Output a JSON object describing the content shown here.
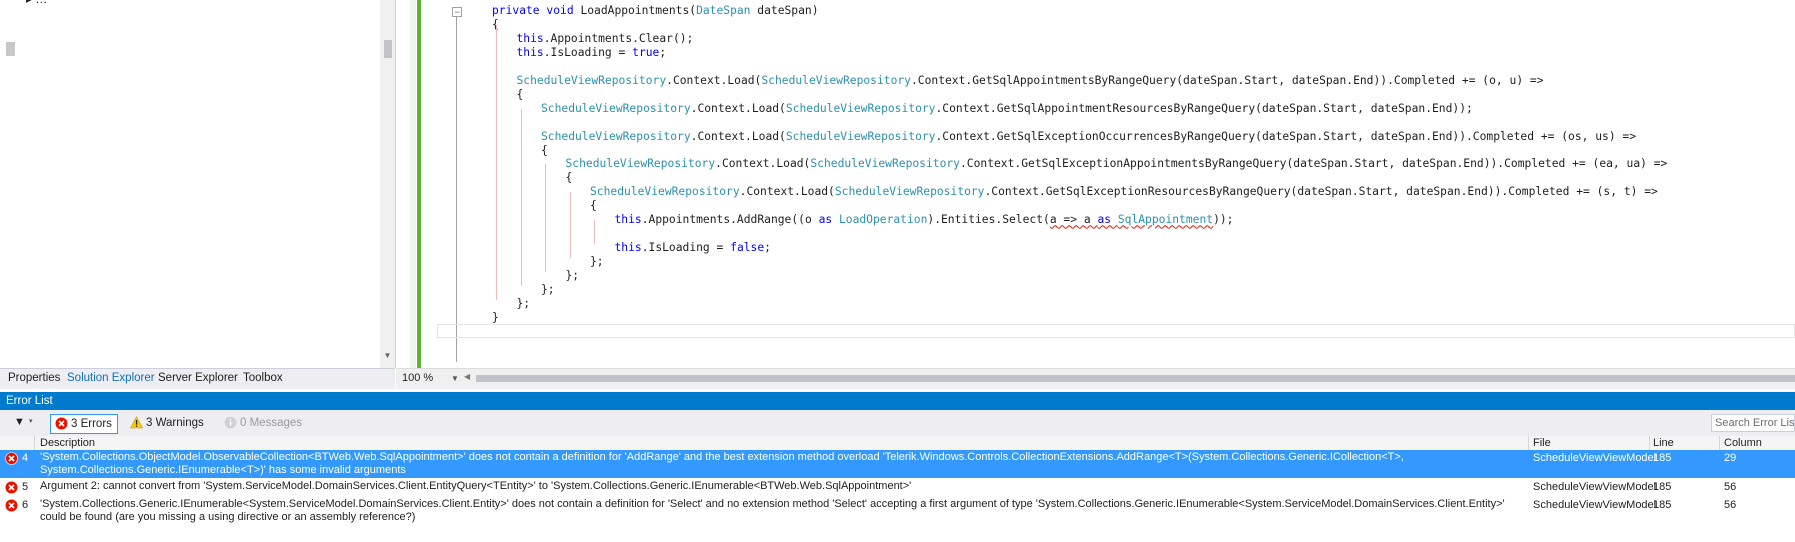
{
  "solution_explorer": {
    "tree_item_fragment": "▸ …",
    "tabs": [
      "Properties",
      "Solution Explorer",
      "Server Explorer",
      "Toolbox"
    ],
    "active_tab": "Solution Explorer"
  },
  "editor": {
    "zoom": "100 %",
    "code_lines": [
      {
        "indent": 0,
        "tokens": [
          {
            "t": "private ",
            "c": "kw"
          },
          {
            "t": "void ",
            "c": "kw"
          },
          {
            "t": "LoadAppointments(",
            "c": ""
          },
          {
            "t": "DateSpan",
            "c": "ty"
          },
          {
            "t": " dateSpan)",
            "c": ""
          }
        ]
      },
      {
        "indent": 0,
        "tokens": [
          {
            "t": "{",
            "c": ""
          }
        ]
      },
      {
        "indent": 1,
        "tokens": [
          {
            "t": "this",
            "c": "kw"
          },
          {
            "t": ".Appointments.Clear();",
            "c": ""
          }
        ]
      },
      {
        "indent": 1,
        "tokens": [
          {
            "t": "this",
            "c": "kw"
          },
          {
            "t": ".IsLoading = ",
            "c": ""
          },
          {
            "t": "true",
            "c": "kw"
          },
          {
            "t": ";",
            "c": ""
          }
        ]
      },
      {
        "indent": 1,
        "tokens": []
      },
      {
        "indent": 1,
        "tokens": [
          {
            "t": "ScheduleViewRepository",
            "c": "ty"
          },
          {
            "t": ".Context.Load(",
            "c": ""
          },
          {
            "t": "ScheduleViewRepository",
            "c": "ty"
          },
          {
            "t": ".Context.GetSqlAppointmentsByRangeQuery(dateSpan.Start, dateSpan.End)).Completed += (o, u) =>",
            "c": ""
          }
        ]
      },
      {
        "indent": 1,
        "tokens": [
          {
            "t": "{",
            "c": ""
          }
        ]
      },
      {
        "indent": 2,
        "tokens": [
          {
            "t": "ScheduleViewRepository",
            "c": "ty"
          },
          {
            "t": ".Context.Load(",
            "c": ""
          },
          {
            "t": "ScheduleViewRepository",
            "c": "ty"
          },
          {
            "t": ".Context.GetSqlAppointmentResourcesByRangeQuery(dateSpan.Start, dateSpan.End));",
            "c": ""
          }
        ]
      },
      {
        "indent": 2,
        "tokens": []
      },
      {
        "indent": 2,
        "tokens": [
          {
            "t": "ScheduleViewRepository",
            "c": "ty"
          },
          {
            "t": ".Context.Load(",
            "c": ""
          },
          {
            "t": "ScheduleViewRepository",
            "c": "ty"
          },
          {
            "t": ".Context.GetSqlExceptionOccurrencesByRangeQuery(dateSpan.Start, dateSpan.End)).Completed += (os, us) =>",
            "c": ""
          }
        ]
      },
      {
        "indent": 2,
        "tokens": [
          {
            "t": "{",
            "c": ""
          }
        ]
      },
      {
        "indent": 3,
        "tokens": [
          {
            "t": "ScheduleViewRepository",
            "c": "ty"
          },
          {
            "t": ".Context.Load(",
            "c": ""
          },
          {
            "t": "ScheduleViewRepository",
            "c": "ty"
          },
          {
            "t": ".Context.GetSqlExceptionAppointmentsByRangeQuery(dateSpan.Start, dateSpan.End)).Completed += (ea, ua) =>",
            "c": ""
          }
        ]
      },
      {
        "indent": 3,
        "tokens": [
          {
            "t": "{",
            "c": ""
          }
        ]
      },
      {
        "indent": 4,
        "tokens": [
          {
            "t": "ScheduleViewRepository",
            "c": "ty"
          },
          {
            "t": ".Context.Load(",
            "c": ""
          },
          {
            "t": "ScheduleViewRepository",
            "c": "ty"
          },
          {
            "t": ".Context.GetSqlExceptionResourcesByRangeQuery(dateSpan.Start, dateSpan.End)).Completed += (s, t) =>",
            "c": ""
          }
        ]
      },
      {
        "indent": 4,
        "tokens": [
          {
            "t": "{",
            "c": ""
          }
        ]
      },
      {
        "indent": 5,
        "tokens": [
          {
            "t": "this",
            "c": "kw"
          },
          {
            "t": ".Appointments.AddRange((o ",
            "c": ""
          },
          {
            "t": "as ",
            "c": "kw"
          },
          {
            "t": "LoadOperation",
            "c": "ty"
          },
          {
            "t": ").Entities.Select(",
            "c": ""
          },
          {
            "t": "a => a ",
            "c": "sq"
          },
          {
            "t": "as ",
            "c": "kw sq"
          },
          {
            "t": "SqlAppointment",
            "c": "ty sq"
          },
          {
            "t": "));",
            "c": ""
          }
        ]
      },
      {
        "indent": 5,
        "tokens": []
      },
      {
        "indent": 5,
        "tokens": [
          {
            "t": "this",
            "c": "kw"
          },
          {
            "t": ".IsLoading = ",
            "c": ""
          },
          {
            "t": "false",
            "c": "kw"
          },
          {
            "t": ";",
            "c": ""
          }
        ]
      },
      {
        "indent": 4,
        "tokens": [
          {
            "t": "};",
            "c": ""
          }
        ]
      },
      {
        "indent": 3,
        "tokens": [
          {
            "t": "};",
            "c": ""
          }
        ]
      },
      {
        "indent": 2,
        "tokens": [
          {
            "t": "};",
            "c": ""
          }
        ]
      },
      {
        "indent": 1,
        "tokens": [
          {
            "t": "};",
            "c": ""
          }
        ]
      },
      {
        "indent": 0,
        "tokens": [
          {
            "t": "}",
            "c": ""
          }
        ]
      }
    ]
  },
  "error_list": {
    "title": "Error List",
    "errors_label": "3 Errors",
    "warnings_label": "3 Warnings",
    "messages_label": "0 Messages",
    "search_placeholder": "Search Error List",
    "columns": {
      "description": "Description",
      "file": "File",
      "line": "Line",
      "column": "Column"
    },
    "rows": [
      {
        "num": "4",
        "description": "'System.Collections.ObjectModel.ObservableCollection<BTWeb.Web.SqlAppointment>' does not contain a definition for 'AddRange' and the best extension method overload 'Telerik.Windows.Controls.CollectionExtensions.AddRange<T>(System.Collections.Generic.ICollection<T>, System.Collections.Generic.IEnumerable<T>)' has some invalid arguments",
        "file": "ScheduleViewViewModel",
        "line": "185",
        "column": "29",
        "selected": true
      },
      {
        "num": "5",
        "description": "Argument 2: cannot convert from 'System.ServiceModel.DomainServices.Client.EntityQuery<TEntity>' to 'System.Collections.Generic.IEnumerable<BTWeb.Web.SqlAppointment>'",
        "file": "ScheduleViewViewModel",
        "line": "185",
        "column": "56",
        "selected": false
      },
      {
        "num": "6",
        "description": "'System.Collections.Generic.IEnumerable<System.ServiceModel.DomainServices.Client.Entity>' does not contain a definition for 'Select' and no extension method 'Select' accepting a first argument of type 'System.Collections.Generic.IEnumerable<System.ServiceModel.DomainServices.Client.Entity>' could be found (are you missing a using directive or an assembly reference?)",
        "file": "ScheduleViewViewModel",
        "line": "185",
        "column": "56",
        "selected": false
      }
    ]
  },
  "colors": {
    "accent": "#007acc",
    "selection": "#3399ff",
    "error": "#e51400",
    "warning": "#ffcc00",
    "keyword": "#0000ff",
    "type": "#2b91af",
    "changed_margin": "#5fb336"
  }
}
